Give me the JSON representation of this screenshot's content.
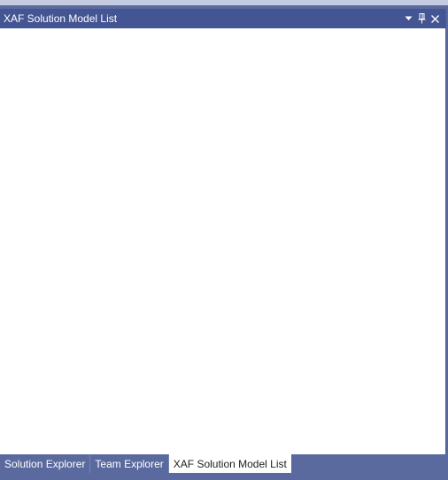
{
  "tool_window": {
    "title": "XAF Solution Model List",
    "buttons": {
      "dropdown_icon": "chevron-down-icon",
      "pin_icon": "pin-icon",
      "close_icon": "close-icon"
    }
  },
  "tabs": [
    {
      "label": "Solution Explorer",
      "active": false
    },
    {
      "label": "Team Explorer",
      "active": false
    },
    {
      "label": "XAF Solution Model List",
      "active": true
    }
  ],
  "colors": {
    "title_bar": "#445593",
    "frame": "#5a6a9e",
    "top_strip": "#c3cbe1",
    "content_background": "#ffffff",
    "active_tab_background": "#ffffff"
  }
}
